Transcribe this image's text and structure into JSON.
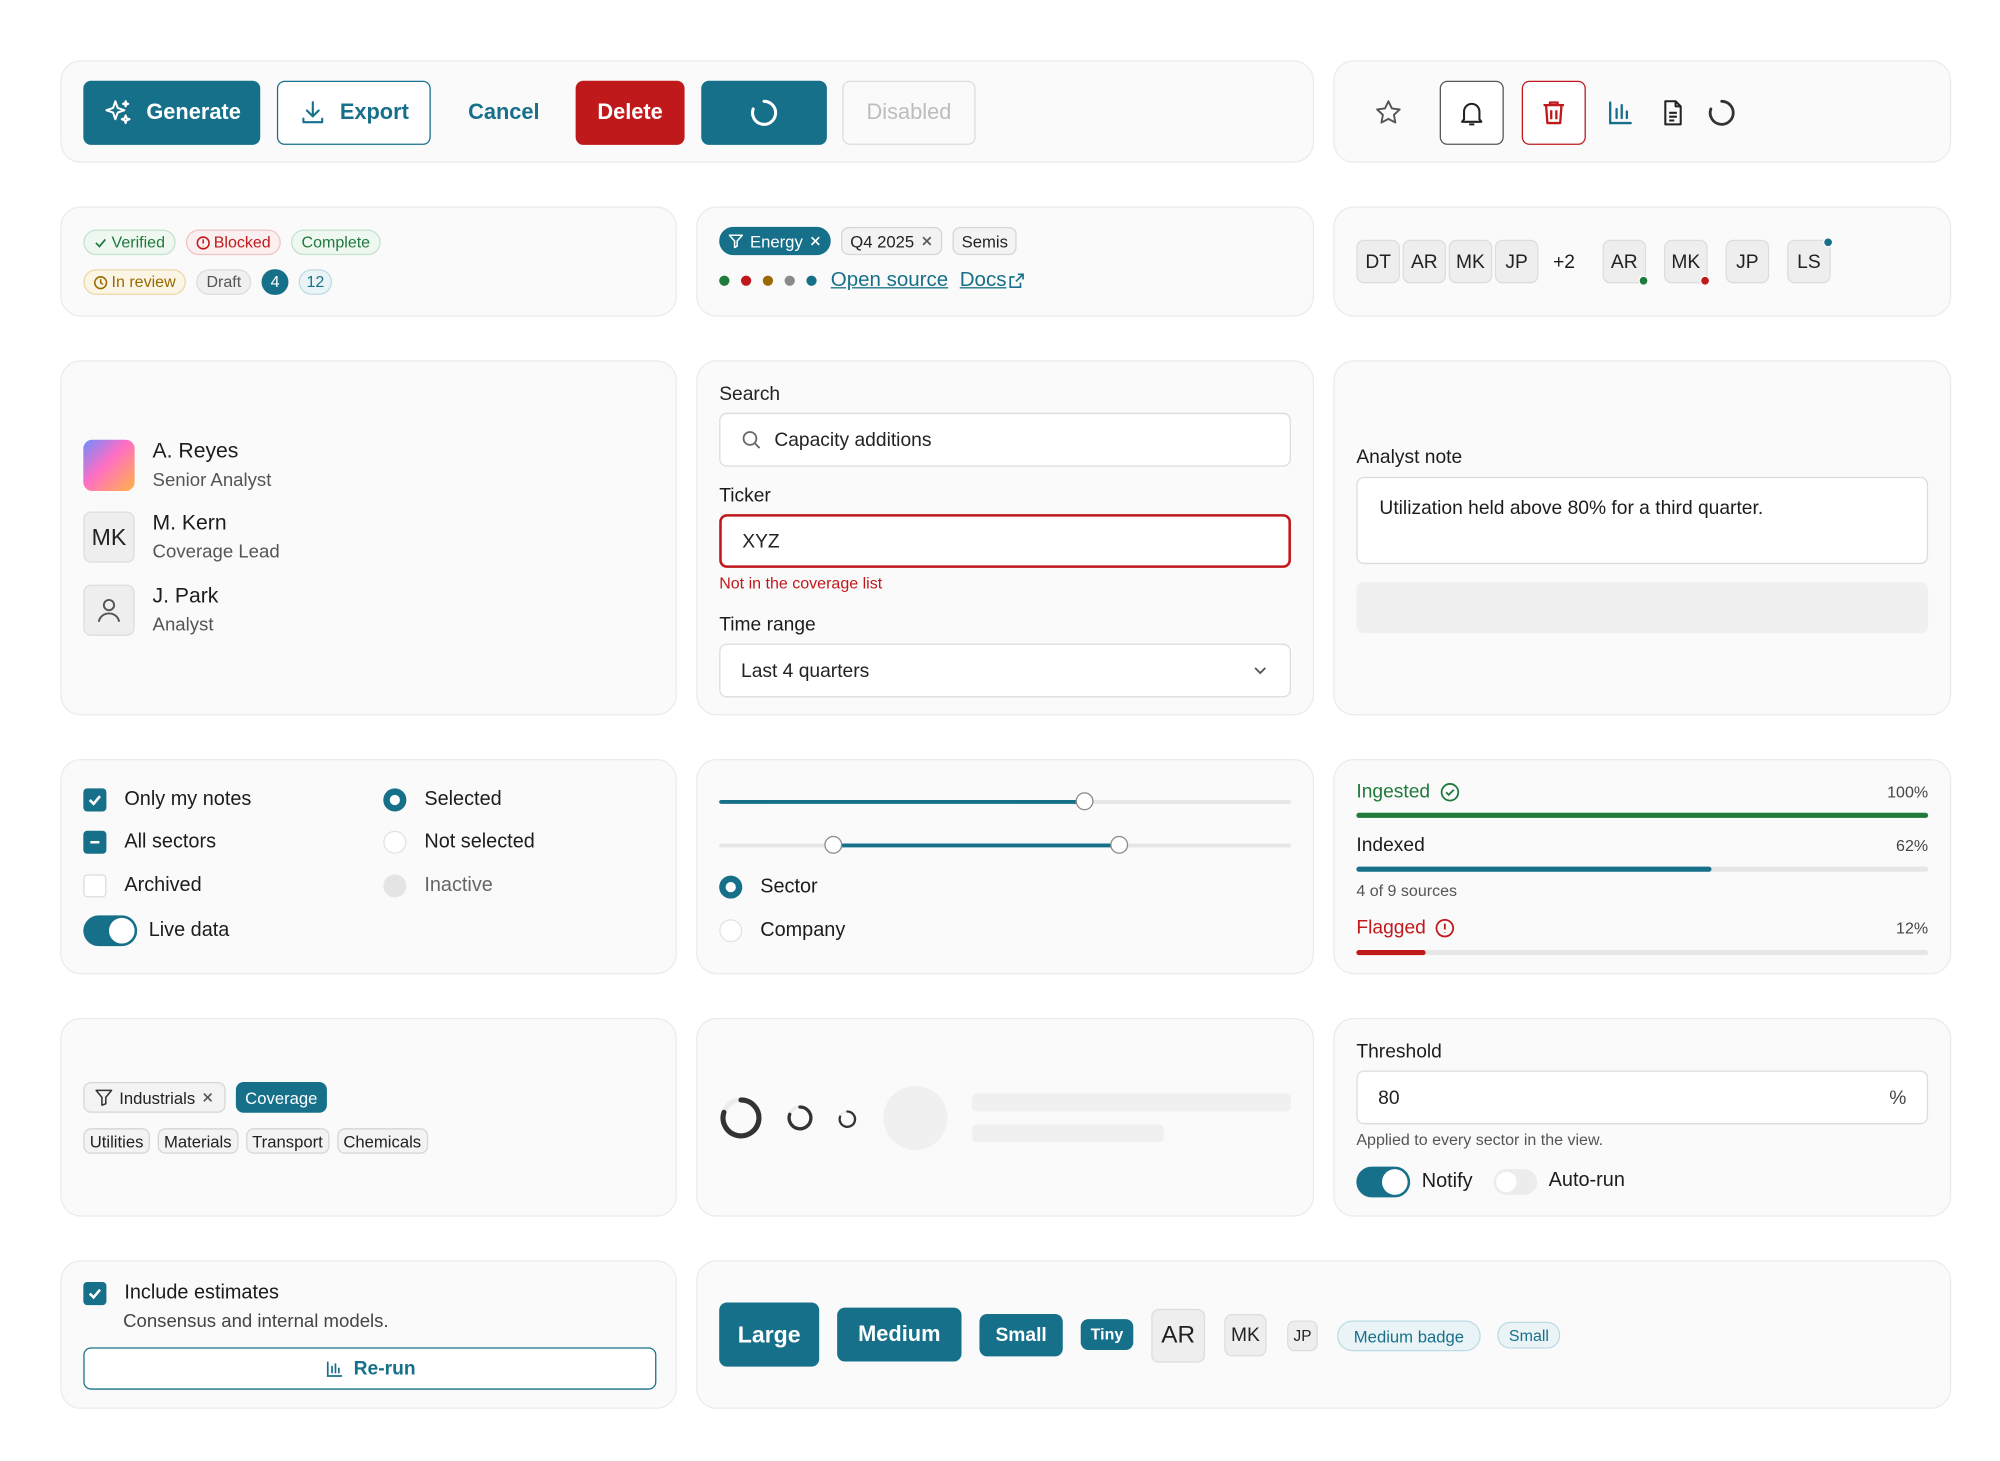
{
  "buttons": {
    "generate": "Generate",
    "export": "Export",
    "cancel": "Cancel",
    "delete": "Delete",
    "disabled": "Disabled"
  },
  "status_badges": {
    "verified": "Verified",
    "blocked": "Blocked",
    "complete": "Complete",
    "in_review": "In review",
    "draft": "Draft",
    "count_a": "4",
    "count_b": "12"
  },
  "filters": {
    "energy": "Energy",
    "quarter": "Q4 2025",
    "semis": "Semis",
    "link_open_source": "Open source",
    "link_docs": "Docs",
    "dot_colors": [
      "#1f7a3c",
      "#c0191c",
      "#9a6a00",
      "#8a8a8a",
      "#17708a"
    ]
  },
  "avatars": {
    "group": [
      "DT",
      "AR",
      "MK",
      "JP"
    ],
    "overflow": "+2",
    "status": [
      {
        "initials": "AR",
        "dot": "#1f7a3c"
      },
      {
        "initials": "MK",
        "dot": "#c0191c"
      },
      {
        "initials": "JP",
        "dot": ""
      },
      {
        "initials": "LS",
        "dot": "#17708a"
      }
    ]
  },
  "people": [
    {
      "name": "A. Reyes",
      "role": "Senior Analyst"
    },
    {
      "name": "M. Kern",
      "role": "Coverage Lead",
      "initials": "MK"
    },
    {
      "name": "J. Park",
      "role": "Analyst"
    }
  ],
  "form": {
    "search_label": "Search",
    "search_value": "Capacity additions",
    "ticker_label": "Ticker",
    "ticker_value": "XYZ",
    "ticker_error": "Not in the coverage list",
    "time_label": "Time range",
    "time_value": "Last 4 quarters"
  },
  "note": {
    "label": "Analyst note",
    "text": "Utilization held above 80% for a third quarter."
  },
  "checks": {
    "only_my_notes": "Only my notes",
    "all_sectors": "All sectors",
    "archived": "Archived",
    "live_data": "Live data",
    "selected": "Selected",
    "not_selected": "Not selected",
    "inactive": "Inactive"
  },
  "sliders": {
    "single_value": 0.64,
    "range": [
      0.2,
      0.7
    ],
    "sector": "Sector",
    "company": "Company"
  },
  "progress": [
    {
      "label": "Ingested",
      "percent": "100%",
      "value": 1.0,
      "color": "#1f7a3c"
    },
    {
      "label": "Indexed",
      "percent": "62%",
      "value": 0.62,
      "color": "#17708a",
      "sub": "4 of 9 sources"
    },
    {
      "label": "Flagged",
      "percent": "12%",
      "value": 0.12,
      "color": "#c0191c"
    }
  ],
  "tags": {
    "industrials": "Industrials",
    "coverage": "Coverage",
    "list": [
      "Utilities",
      "Materials",
      "Transport",
      "Chemicals"
    ]
  },
  "threshold": {
    "label": "Threshold",
    "value": "80",
    "unit": "%",
    "help": "Applied to every sector in the view.",
    "notify": "Notify",
    "autorun": "Auto-run"
  },
  "estimates": {
    "title": "Include estimates",
    "desc": "Consensus and internal models.",
    "rerun": "Re-run"
  },
  "sizes": {
    "large": "Large",
    "medium": "Medium",
    "small": "Small",
    "tiny": "Tiny",
    "av_large": "AR",
    "av_medium": "MK",
    "av_small": "JP",
    "badge_medium": "Medium badge",
    "badge_small": "Small"
  }
}
